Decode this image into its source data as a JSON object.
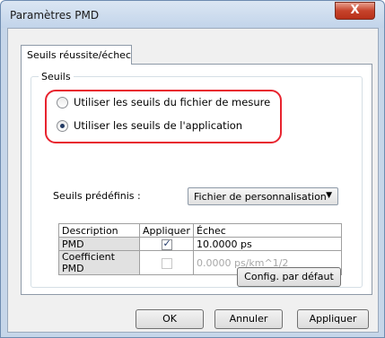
{
  "window": {
    "title": "Paramètres PMD",
    "close_glyph": "X"
  },
  "tabs": [
    {
      "label": "Seuils réussite/échec",
      "active": true
    }
  ],
  "group": {
    "label": "Seuils",
    "radio_options": [
      {
        "label": "Utiliser les seuils du fichier de mesure",
        "checked": false
      },
      {
        "label": "Utiliser les seuils de l'application",
        "checked": true
      }
    ]
  },
  "predefined": {
    "label": "Seuils prédéfinis :",
    "value": "Fichier de personnalisation",
    "arrow": "▼"
  },
  "table": {
    "headers": [
      "Description",
      "Appliquer",
      "Échec"
    ],
    "rows": [
      {
        "description": "PMD",
        "apply": true,
        "enabled": true,
        "value": "10.0000 ps"
      },
      {
        "description": "Coefficient PMD",
        "apply": false,
        "enabled": false,
        "value": "0.0000 ps/km^1/2"
      }
    ]
  },
  "buttons": {
    "default_config": "Config. par défaut",
    "ok": "OK",
    "cancel": "Annuler",
    "apply": "Appliquer"
  },
  "colors": {
    "highlight_ring": "#e8232e",
    "close_button": "#c6432b"
  }
}
